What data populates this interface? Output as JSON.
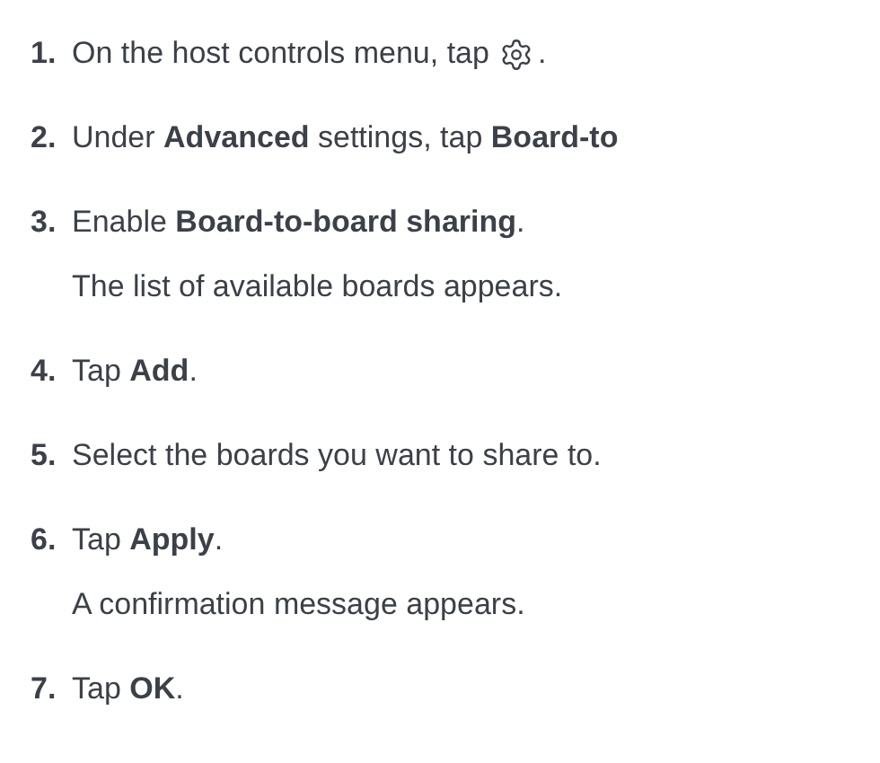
{
  "steps": [
    {
      "number": "1.",
      "text": "On the host controls menu, tap",
      "has_icon": true,
      "after_icon": "."
    },
    {
      "number": "2.",
      "text": "Under **Advanced** settings, tap **Board-to**"
    },
    {
      "number": "3.",
      "text": "Enable **Board-to-board sharing**.",
      "note": "The list of available boards appears."
    },
    {
      "number": "4.",
      "text": "Tap **Add**."
    },
    {
      "number": "5.",
      "text": "Select the boards you want to share to."
    },
    {
      "number": "6.",
      "text": "Tap **Apply**.",
      "note": "A confirmation message appears."
    },
    {
      "number": "7.",
      "text": "Tap **OK**."
    }
  ]
}
